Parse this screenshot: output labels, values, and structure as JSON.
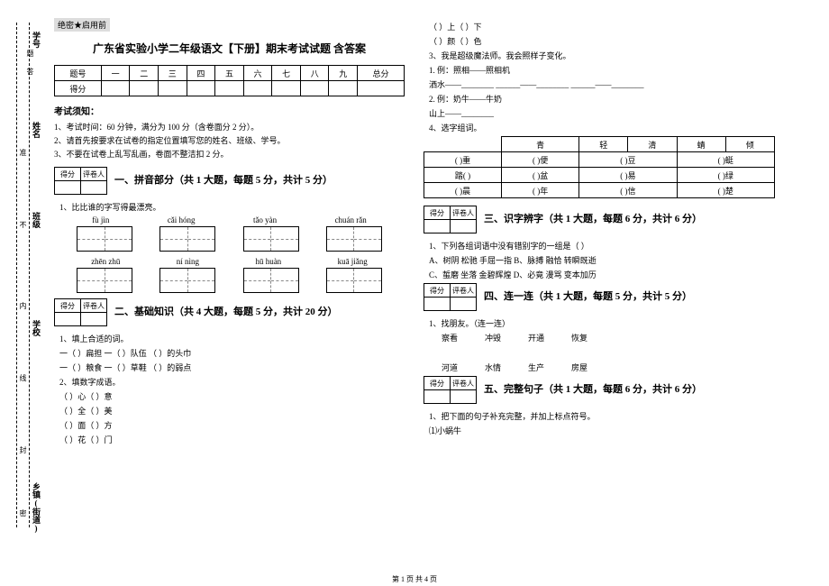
{
  "margin": {
    "labels": [
      "学号",
      "姓名",
      "班级",
      "学校",
      "乡镇(街道)"
    ],
    "hints": [
      "准",
      "不",
      "内",
      "线",
      "封",
      "密"
    ],
    "side": [
      "题",
      "答"
    ]
  },
  "secret": "绝密★启用前",
  "title": "广东省实验小学二年级语文【下册】期末考试试题 含答案",
  "score_table": {
    "row1": [
      "题号",
      "一",
      "二",
      "三",
      "四",
      "五",
      "六",
      "七",
      "八",
      "九",
      "总分"
    ],
    "row2_label": "得分"
  },
  "notice_hdr": "考试须知：",
  "notices": [
    "1、考试时间：60 分钟，满分为 100 分（含卷面分 2 分）。",
    "2、请首先按要求在试卷的指定位置填写您的姓名、班级、学号。",
    "3、不要在试卷上乱写乱画，卷面不整洁扣 2 分。"
  ],
  "scorebox": {
    "c1": "得分",
    "c2": "评卷人"
  },
  "sec1": "一、拼音部分（共 1 大题，每题 5 分，共计 5 分）",
  "q1_1": "1、比比谁的字写得最漂亮。",
  "pinyin_row1": [
    "fù  jìn",
    "cǎi  hóng",
    "tǎo  yàn",
    "chuán rǎn"
  ],
  "pinyin_row2": [
    "zhēn  zhū",
    "ní  nìng",
    "hū  huàn",
    "kuā  jiǎng"
  ],
  "sec2": "二、基础知识（共 4 大题，每题 5 分，共计 20 分）",
  "q2_1": "1、填上合适的词。",
  "q2_1_lines": [
    "一（   ）扁担      一（   ）队伍      （     ）的头巾",
    "一（   ）粮食      一（   ）草鞋      （     ）的弱点"
  ],
  "q2_2": "2、填数字成语。",
  "q2_2_lines": [
    "（   ）心（   ）意",
    "（   ）全（   ）美",
    "（   ）面（   ）方",
    "（   ）花（   ）门"
  ],
  "q2_2b_lines": [
    "（   ）上（   ）下",
    "（   ）颜（   ）色"
  ],
  "q2_3": "3、我是超级魔法师。我会照样子变化。",
  "q2_3_lines": [
    "1. 例：照相——照相机",
    "洒水——________      ______——________      ______——________",
    "2. 例：奶牛——牛奶",
    "山上——________"
  ],
  "q2_4": "4、选字组词。",
  "char_header": [
    "青",
    "轻",
    "清",
    "蜻",
    "倾"
  ],
  "char_rows": [
    [
      "(    )重",
      "(    )便",
      "(    )豆",
      "(    )蜓"
    ],
    [
      "踏(    )",
      "(    )盆",
      "(    )易",
      "(    )绿"
    ],
    [
      "(    )晨",
      "(    )年",
      "(    )信",
      "(    )楚"
    ]
  ],
  "sec3": "三、识字辨字（共 1 大题，每题 6 分，共计 6 分）",
  "q3_1": "1、下列各组词语中没有错别字的一组是（    ）",
  "q3_opts": [
    "A、树阴    松驰    手屈一指    B、脉搏    融恰    转瞬既逝",
    "C、蜇磨    坐落    金碧辉煌    D、必竟    漫骂    变本加历"
  ],
  "sec4": "四、连一连（共 1 大题，每题 5 分，共计 5 分）",
  "q4_1": "1、找朋友。（连一连）",
  "q4_row1": [
    "察看",
    "冲毁",
    "开通",
    "恢复"
  ],
  "q4_row2": [
    "河道",
    "水情",
    "生产",
    "房屋"
  ],
  "sec5": "五、完整句子（共 1 大题，每题 6 分，共计 6 分）",
  "q5_1": "1、把下面的句子补充完整，并加上标点符号。",
  "q5_1a": "⑴小蜗牛",
  "footer": "第 1 页 共 4 页"
}
